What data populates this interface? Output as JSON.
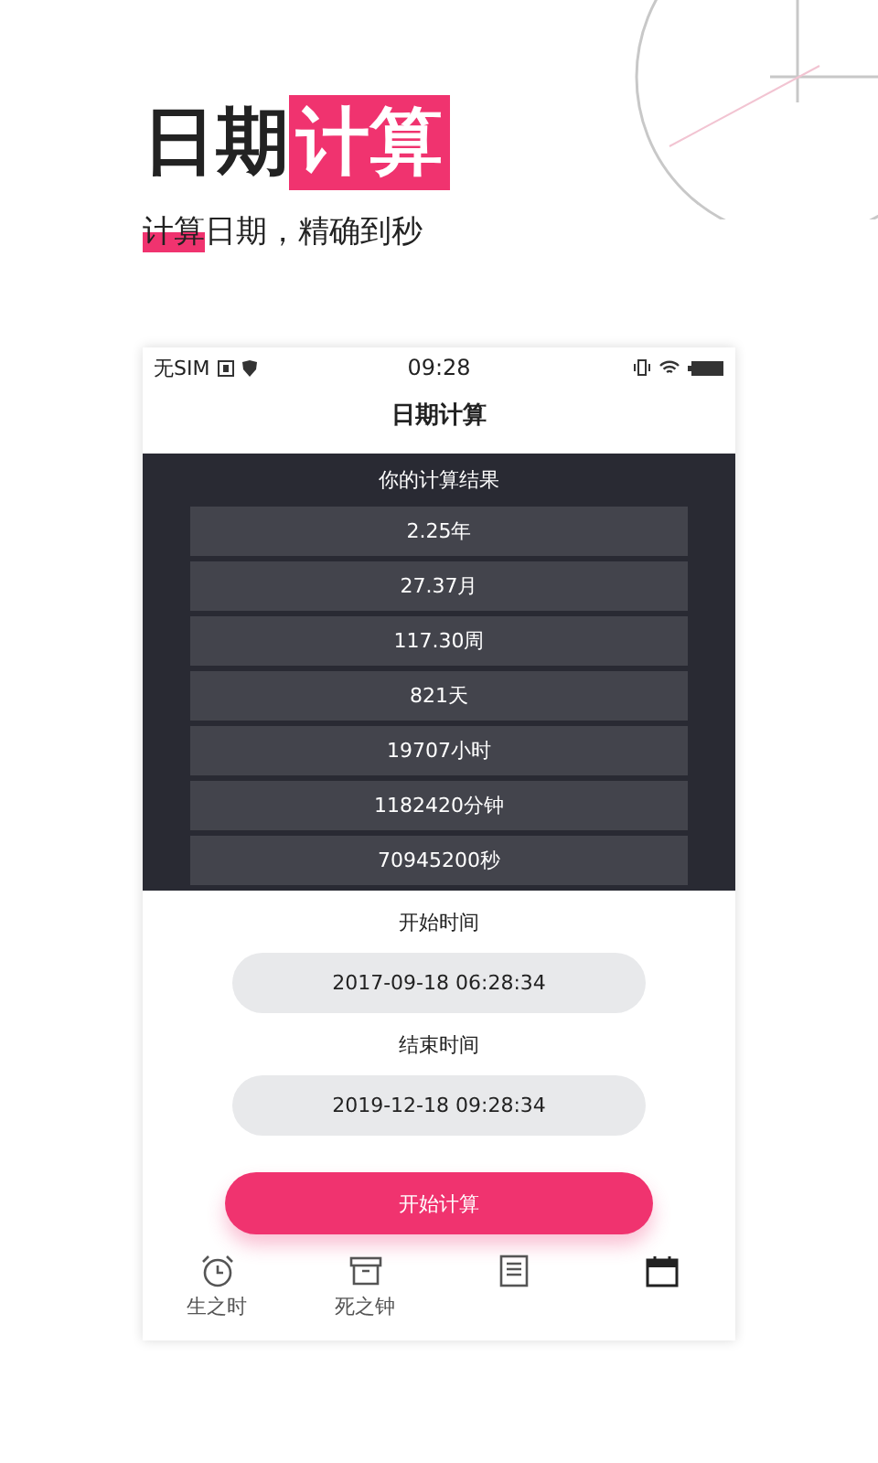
{
  "headline": {
    "plain": "日期",
    "highlight": "计算"
  },
  "subtitle": {
    "highlight": "计算",
    "plain": "日期，精确到秒"
  },
  "status_bar": {
    "carrier": "无SIM",
    "time": "09:28"
  },
  "app_title": "日期计算",
  "results": {
    "heading": "你的计算结果",
    "rows": [
      "2.25年",
      "27.37月",
      "117.30周",
      "821天",
      "19707小时",
      "1182420分钟",
      "70945200秒"
    ]
  },
  "start": {
    "label": "开始时间",
    "value": "2017-09-18 06:28:34"
  },
  "end": {
    "label": "结束时间",
    "value": "2019-12-18 09:28:34"
  },
  "calculate_button": "开始计算",
  "tabs": [
    {
      "kind": "alarm",
      "label": "生之时",
      "selected": false
    },
    {
      "kind": "box",
      "label": "死之钟",
      "selected": false
    },
    {
      "kind": "note",
      "selected": false
    },
    {
      "kind": "calendar",
      "selected": true
    }
  ]
}
